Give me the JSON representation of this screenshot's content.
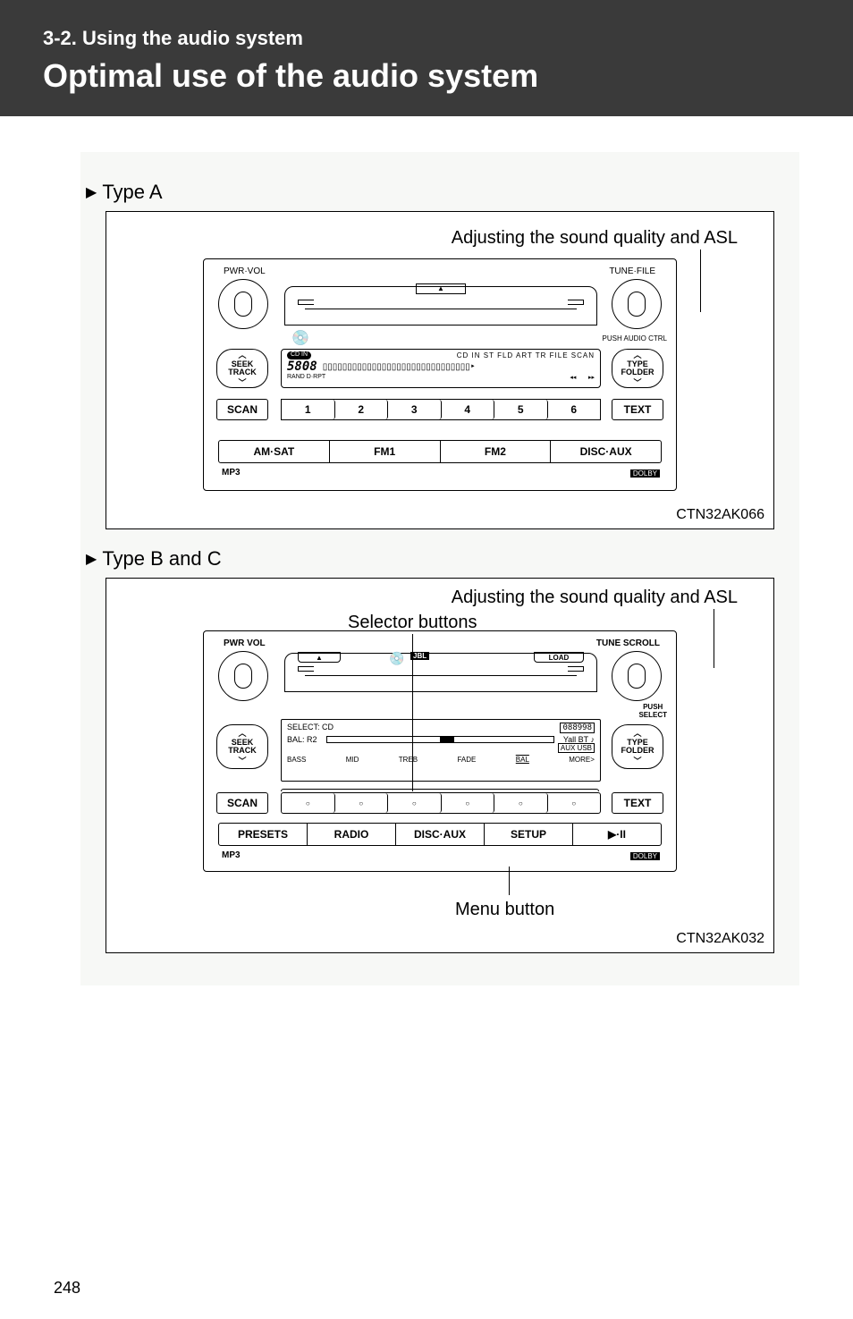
{
  "header": {
    "section": "3-2. Using the audio system",
    "title": "Optimal use of the audio system"
  },
  "typeA": {
    "heading": "Type A",
    "annotation": "Adjusting the sound quality and ASL",
    "caption": "CTN32AK066",
    "radio": {
      "pwr": "PWR·VOL",
      "tune": "TUNE·FILE",
      "push": "PUSH AUDIO CTRL",
      "seek": "SEEK\nTRACK",
      "type": "TYPE\nFOLDER",
      "scan": "SCAN",
      "text": "TEXT",
      "amsat": "AM·SAT",
      "fm1": "FM1",
      "fm2": "FM2",
      "discaux": "DISC·AUX",
      "mp3": "MP3",
      "dolby": "DOLBY",
      "presets": [
        "1",
        "2",
        "3",
        "4",
        "5",
        "6"
      ],
      "displayIcons": "CD IN   ST  FLD ART TR FILE   SCAN",
      "displayNum": "5808",
      "displayRand": "RAND  D·RPT"
    }
  },
  "typeB": {
    "heading": "Type B and C",
    "annTop": "Adjusting the sound quality and ASL",
    "annSel": "Selector buttons",
    "annMenu": "Menu button",
    "caption": "CTN32AK032",
    "radio": {
      "pwr": "PWR VOL",
      "tune": "TUNE SCROLL",
      "push": "PUSH\nSELECT",
      "load": "LOAD",
      "seek": "SEEK\nTRACK",
      "type": "TYPE\nFOLDER",
      "scan": "SCAN",
      "text": "TEXT",
      "presets": "PRESETS",
      "radiobtn": "RADIO",
      "discaux": "DISC·AUX",
      "setup": "SETUP",
      "play": "▶·II",
      "mp3": "MP3",
      "dolby": "DOLBY",
      "jbl": "JBL",
      "dispSelect": "SELECT: CD",
      "dispBal": "BAL: R2",
      "dispIcons": "088998",
      "dispBT": "Yall BT ♪",
      "dispAux": "AUX USB",
      "selectors": [
        "BASS",
        "MID",
        "TREB",
        "FADE",
        "BAL",
        "MORE>"
      ]
    }
  },
  "page": "248"
}
